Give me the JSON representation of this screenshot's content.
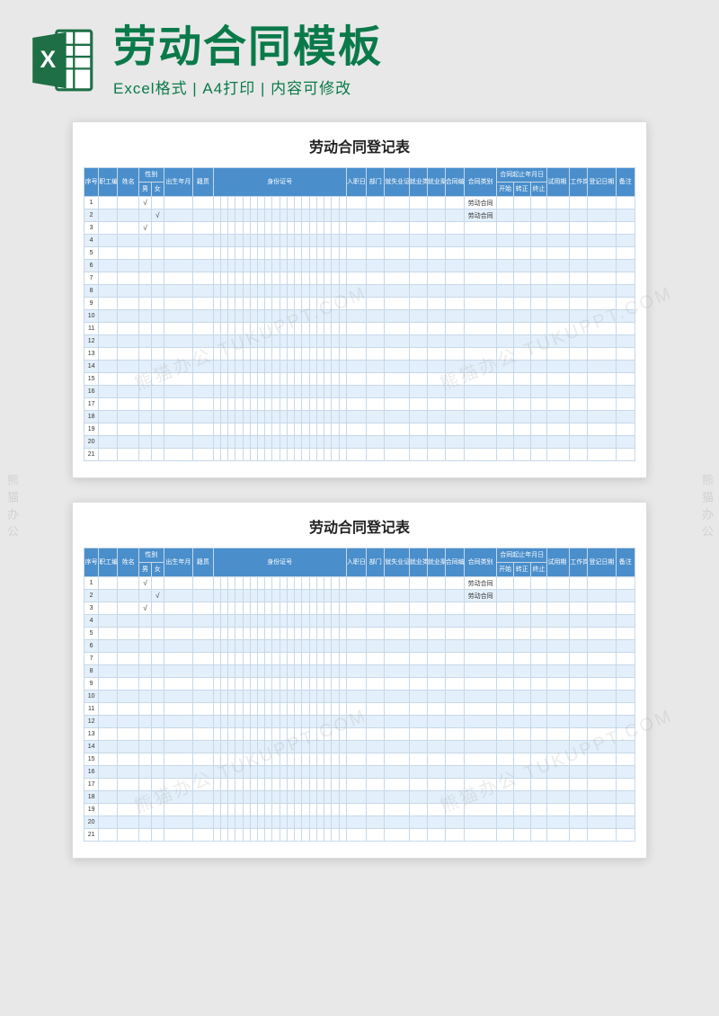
{
  "hero": {
    "title": "劳动合同模板",
    "subtitle": "Excel格式 | A4打印 | 内容可修改",
    "icon_name": "excel-logo-icon",
    "icon_letter": "X"
  },
  "sheet_title": "劳动合同登记表",
  "headers": {
    "seq": "序号",
    "emp_no": "职工编号",
    "name": "姓名",
    "sex_group": "性别",
    "sex_m": "男",
    "sex_f": "女",
    "birth": "出生年月",
    "jiguan": "籍贯",
    "id_no": "身份证号",
    "entry_date": "入职日期",
    "dept": "部门",
    "jiuye_no": "就失业证号",
    "emp_type": "就业类别",
    "channel": "就业渠道",
    "contract_no": "合同编号",
    "contract_type": "合同类别",
    "period_group": "合同起止年月日",
    "period_start": "开始",
    "period_zz": "转正",
    "period_end": "终止",
    "probation": "试用期（天）",
    "post": "工作岗位",
    "reg_date": "登记日期",
    "remark": "备注"
  },
  "id_cols": 18,
  "rows": [
    {
      "seq": 1,
      "sex_m": "√",
      "sex_f": "",
      "contract_type": "劳动合同"
    },
    {
      "seq": 2,
      "sex_m": "",
      "sex_f": "√",
      "contract_type": "劳动合同"
    },
    {
      "seq": 3,
      "sex_m": "√",
      "sex_f": "",
      "contract_type": ""
    },
    {
      "seq": 4,
      "sex_m": "",
      "sex_f": "",
      "contract_type": ""
    },
    {
      "seq": 5,
      "sex_m": "",
      "sex_f": "",
      "contract_type": ""
    },
    {
      "seq": 6,
      "sex_m": "",
      "sex_f": "",
      "contract_type": ""
    },
    {
      "seq": 7,
      "sex_m": "",
      "sex_f": "",
      "contract_type": ""
    },
    {
      "seq": 8,
      "sex_m": "",
      "sex_f": "",
      "contract_type": ""
    },
    {
      "seq": 9,
      "sex_m": "",
      "sex_f": "",
      "contract_type": ""
    },
    {
      "seq": 10,
      "sex_m": "",
      "sex_f": "",
      "contract_type": ""
    },
    {
      "seq": 11,
      "sex_m": "",
      "sex_f": "",
      "contract_type": ""
    },
    {
      "seq": 12,
      "sex_m": "",
      "sex_f": "",
      "contract_type": ""
    },
    {
      "seq": 13,
      "sex_m": "",
      "sex_f": "",
      "contract_type": ""
    },
    {
      "seq": 14,
      "sex_m": "",
      "sex_f": "",
      "contract_type": ""
    },
    {
      "seq": 15,
      "sex_m": "",
      "sex_f": "",
      "contract_type": ""
    },
    {
      "seq": 16,
      "sex_m": "",
      "sex_f": "",
      "contract_type": ""
    },
    {
      "seq": 17,
      "sex_m": "",
      "sex_f": "",
      "contract_type": ""
    },
    {
      "seq": 18,
      "sex_m": "",
      "sex_f": "",
      "contract_type": ""
    },
    {
      "seq": 19,
      "sex_m": "",
      "sex_f": "",
      "contract_type": ""
    },
    {
      "seq": 20,
      "sex_m": "",
      "sex_f": "",
      "contract_type": ""
    },
    {
      "seq": 21,
      "sex_m": "",
      "sex_f": "",
      "contract_type": ""
    }
  ],
  "watermark_text": "熊猫办公 TUKUPPT.COM",
  "side_watermark": "熊猫办公"
}
